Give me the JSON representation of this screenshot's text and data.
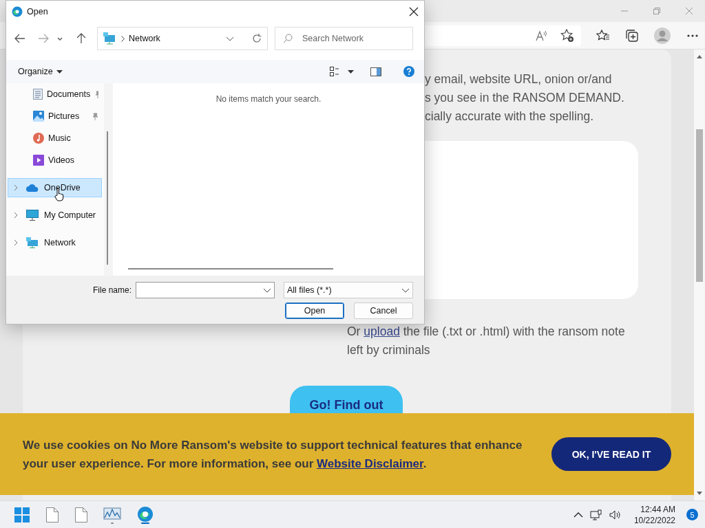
{
  "page": {
    "instruction_lines": [
      "y email, website URL, onion or/and",
      "s you see in the RANSOM DEMAND.",
      "cially accurate with the spelling."
    ],
    "upload_note": {
      "before": "Or ",
      "link": "upload",
      "after": " the file (.txt or .html) with the ransom note left by criminals"
    },
    "submit_button": "Go! Find out"
  },
  "cookie_banner": {
    "message": "We use cookies on No More Ransom's website to support technical features that enhance your user experience. For more information, see our ",
    "link": "Website Disclaimer",
    "after": ".",
    "button": "OK, I'VE READ IT"
  },
  "dialog": {
    "title": "Open",
    "address": "Network",
    "search_placeholder": "Search Network",
    "organize": "Organize",
    "nav_items": [
      {
        "label": "Documents",
        "kind": "documents",
        "pinned": true,
        "has_children": false,
        "selected": false
      },
      {
        "label": "Pictures",
        "kind": "pictures",
        "pinned": true,
        "has_children": false,
        "selected": false
      },
      {
        "label": "Music",
        "kind": "music",
        "pinned": false,
        "has_children": false,
        "selected": false
      },
      {
        "label": "Videos",
        "kind": "videos",
        "pinned": false,
        "has_children": false,
        "selected": false
      },
      {
        "label": "OneDrive",
        "kind": "cloud",
        "pinned": false,
        "has_children": true,
        "selected": true
      },
      {
        "label": "My Computer",
        "kind": "computer",
        "pinned": false,
        "has_children": true,
        "selected": false
      },
      {
        "label": "Network",
        "kind": "network",
        "pinned": false,
        "has_children": true,
        "selected": false
      }
    ],
    "empty_message": "No items match your search.",
    "file_name_label": "File name:",
    "file_type": "All files (*.*)",
    "buttons": [
      {
        "label": "Open",
        "kind": "primary"
      },
      {
        "label": "Cancel",
        "kind": "secondary"
      }
    ]
  },
  "taskbar": {
    "time": "12:44 AM",
    "date": "10/22/2022",
    "notifications": "5"
  }
}
